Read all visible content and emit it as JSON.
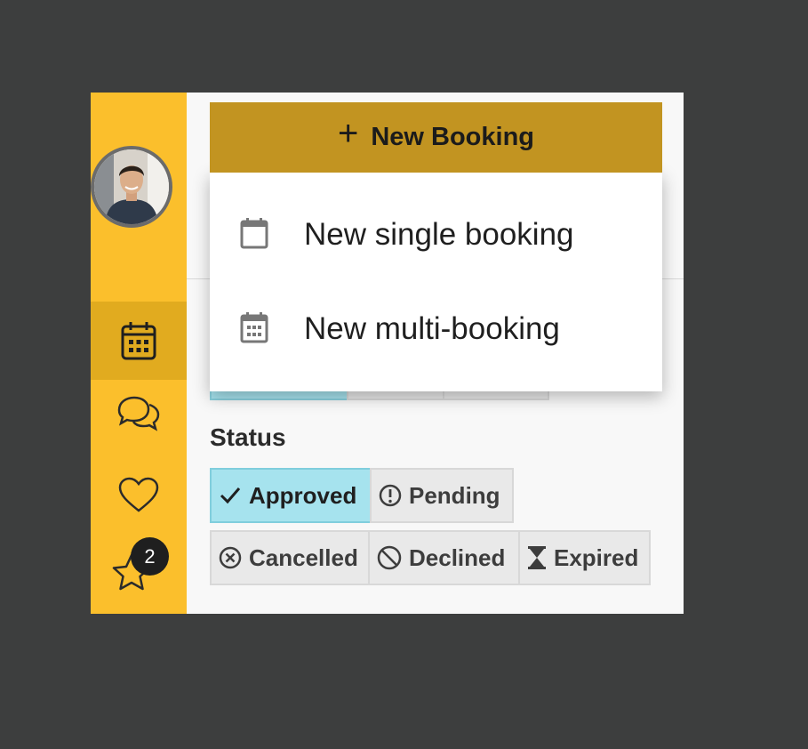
{
  "toolbar": {
    "new_booking_label": "New Booking",
    "plus_symbol": "+"
  },
  "dropdown": {
    "items": [
      {
        "label": "New single booking",
        "icon": "calendar-empty-icon"
      },
      {
        "label": "New multi-booking",
        "icon": "calendar-grid-icon"
      }
    ]
  },
  "sidebar": {
    "avatar": "user-avatar",
    "items": [
      {
        "name": "bookings",
        "icon": "calendar-icon",
        "active": true
      },
      {
        "name": "messages",
        "icon": "chat-bubbles-icon"
      },
      {
        "name": "favorites",
        "icon": "heart-icon"
      },
      {
        "name": "reviews",
        "icon": "star-icon",
        "badge": "2"
      }
    ]
  },
  "filters": {
    "status_title": "Status",
    "status_chips": [
      {
        "label": "Approved",
        "icon": "checkmark-icon",
        "selected": true
      },
      {
        "label": "Pending",
        "icon": "exclamation-circle-icon",
        "selected": false
      },
      {
        "label": "Cancelled",
        "icon": "x-circle-icon",
        "selected": false
      },
      {
        "label": "Declined",
        "icon": "no-entry-icon",
        "selected": false
      },
      {
        "label": "Expired",
        "icon": "hourglass-icon",
        "selected": false
      }
    ]
  },
  "colors": {
    "sidebar": "#fbbf2c",
    "sidebar_active": "#e1ab1f",
    "button": "#c29421",
    "chip_selected": "#a6e3ee",
    "chip": "#e9e9e9",
    "backdrop": "#3d3e3e"
  }
}
